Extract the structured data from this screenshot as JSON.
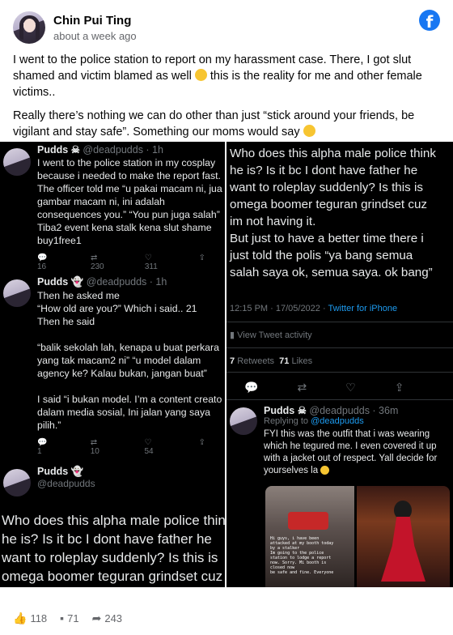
{
  "post": {
    "author": "Chin Pui Ting",
    "time": "about a week ago",
    "paragraph1": "I went to the police station to report on my harassment case. There, I got slut shamed and victim blamed as well",
    "paragraph1_tail": "this is the reality for me and other female victims..",
    "paragraph2": "Really there’s nothing we can do other than just “stick around your friends, be vigilant and stay safe”. Something our moms would say"
  },
  "left": {
    "tweet1": {
      "name": "Pudds",
      "handle": "@deadpudds · 1h",
      "text": "I went to the police station in my cosplay\nbecause i needed to make the report fast.\nThe officer told me “u pakai macam ni, jua\ngambar macam ni, ini adalah\nconsequences you.” “You pun juga salah”\nTiba2 event kena stalk kena slut shame\nbuy1free1",
      "replies": "16",
      "retweets": "230",
      "likes": "311"
    },
    "tweet2": {
      "name": "Pudds",
      "handle": "@deadpudds · 1h",
      "text": "Then he asked me\n“How old are you?” Which i said.. 21\nThen he said\n\n“balik sekolah lah, kenapa u buat perkara\nyang tak macam2 ni” “u model dalam\nagency ke? Kalau bukan, jangan buat”\n\nI said “i bukan model. I’m a content creato\ndalam media sosial, Ini jalan yang saya\npilih.”",
      "replies": "1",
      "retweets": "10",
      "likes": "54"
    },
    "tweet3": {
      "name": "Pudds",
      "handle": "@deadpudds",
      "text": "Who does this alpha male police think\nhe is? Is it bc I dont have father he\nwant to roleplay suddenly? Is this is\nomega boomer teguran grindset cuz"
    }
  },
  "right": {
    "text": "Who does this alpha male police think\nhe is? Is it bc I dont have father he\nwant to roleplay suddenly? Is this is\nomega boomer teguran grindset cuz\nim not having it.\nBut just to have a better time there i\njust told the polis “ya bang semua\nsalah saya ok, semua saya. ok bang”",
    "timestamp": "12:15 PM · 17/05/2022 · ",
    "source": "Twitter for iPhone",
    "activity": "View Tweet activity",
    "retweets_count": "7",
    "retweets_label": "Retweets",
    "likes_count": "71",
    "likes_label": "Likes",
    "reply": {
      "name": "Pudds",
      "handle": "@deadpudds · 36m",
      "replying_label": "Replying to ",
      "replying_handle": "@deadpudds",
      "text": "FYI this was the outfit that i was wearing\nwhich he tegured me. I even covered it up\nwith a jacket out of respect. Yall decide for\nyourselves la",
      "photo_caption": "Hi guys, i have been\nattacked at my booth today\nby a stalker\nIm going to the police\nstation to lodge a report\nnow. Sorry. Mi booth is\nclosed now\nbe safe and fine. Everyone"
    }
  },
  "footer": {
    "likes": "118",
    "comments": "71",
    "shares": "243"
  },
  "colors": {
    "facebook_blue": "#1877f2",
    "twitter_blue": "#1d9bf0",
    "tweet_bg": "#000000"
  },
  "icons": [
    "facebook-icon",
    "reply-icon",
    "retweet-icon",
    "like-icon",
    "share-icon",
    "thumbs-up-icon",
    "comment-icon",
    "share-arrow-icon"
  ]
}
